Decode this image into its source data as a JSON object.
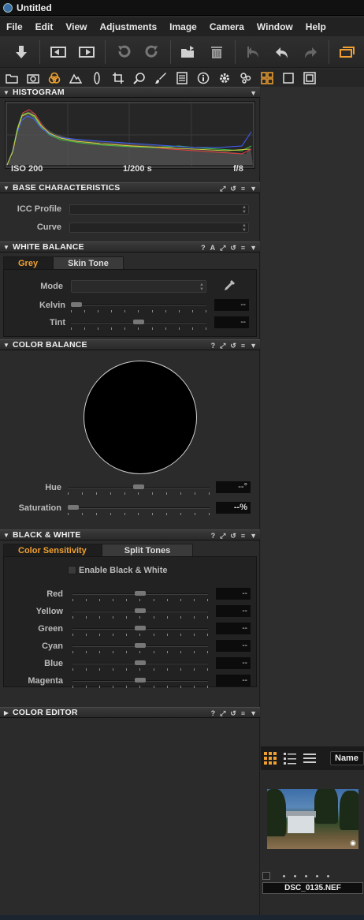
{
  "window": {
    "title": "Untitled"
  },
  "menu": [
    "File",
    "Edit",
    "View",
    "Adjustments",
    "Image",
    "Camera",
    "Window",
    "Help"
  ],
  "toolbar_icons": [
    "import-icon",
    "split-left-icon",
    "split-right-icon",
    "rotate-left-icon",
    "rotate-right-icon",
    "folder-icon",
    "trash-icon",
    "undo-all-icon",
    "undo-icon",
    "redo-icon",
    "stack-icon"
  ],
  "tool_tabs": [
    "library-tab-icon",
    "camera-tab-icon",
    "color-tab-icon",
    "exposure-tab-icon",
    "lens-tab-icon",
    "crop-tab-icon",
    "focus-tab-icon",
    "brush-tab-icon",
    "details-tab-icon",
    "metadata-tab-icon",
    "settings-tab-icon",
    "batch-tab-icon",
    "grid-view-icon",
    "single-view-icon",
    "compare-view-icon"
  ],
  "accent_color": "#f0a030",
  "histogram": {
    "title": "HISTOGRAM",
    "iso": "ISO 200",
    "shutter": "1/200 s",
    "aperture": "f/8"
  },
  "base_characteristics": {
    "title": "BASE CHARACTERISTICS",
    "icc_label": "ICC Profile",
    "curve_label": "Curve"
  },
  "white_balance": {
    "title": "WHITE BALANCE",
    "tabs": [
      "Grey",
      "Skin Tone"
    ],
    "mode_label": "Mode",
    "kelvin_label": "Kelvin",
    "kelvin_value": "--",
    "tint_label": "Tint",
    "tint_value": "--"
  },
  "color_balance": {
    "title": "COLOR BALANCE",
    "hue_label": "Hue",
    "hue_value": "--°",
    "saturation_label": "Saturation",
    "saturation_value": "--%"
  },
  "black_white": {
    "title": "BLACK & WHITE",
    "tabs": [
      "Color Sensitivity",
      "Split Tones"
    ],
    "enable_label": "Enable Black & White",
    "channels": [
      {
        "label": "Red",
        "value": "--"
      },
      {
        "label": "Yellow",
        "value": "--"
      },
      {
        "label": "Green",
        "value": "--"
      },
      {
        "label": "Cyan",
        "value": "--"
      },
      {
        "label": "Blue",
        "value": "--"
      },
      {
        "label": "Magenta",
        "value": "--"
      }
    ]
  },
  "color_editor": {
    "title": "COLOR EDITOR"
  },
  "header_controls": {
    "help": "?",
    "auto": "A"
  },
  "browser": {
    "sort_label": "Name",
    "thumbnail_name": "DSC_0135.NEF"
  }
}
